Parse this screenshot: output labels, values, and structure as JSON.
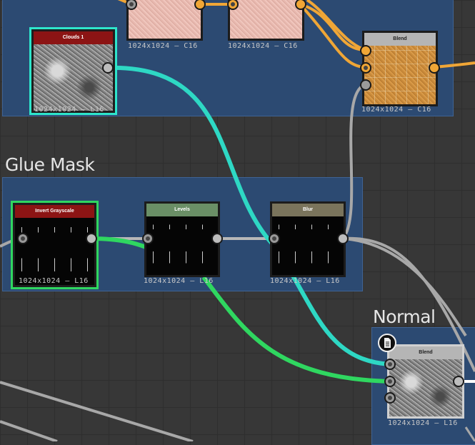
{
  "graph": {
    "frames": {
      "top": {
        "title": ""
      },
      "glue_mask": {
        "title": "Glue Mask"
      },
      "normal": {
        "title": "Normal"
      }
    },
    "nodes": {
      "pink1": {
        "title": "",
        "resolution": "1024x1024 – C16"
      },
      "pink2": {
        "title": "",
        "resolution": "1024x1024 – C16"
      },
      "clouds": {
        "title": "Clouds 1",
        "resolution": "1024x1024 – L16"
      },
      "blend_top": {
        "title": "Blend",
        "resolution": "1024x1024 – C16"
      },
      "invert": {
        "title": "Invert Grayscale",
        "resolution": "1024x1024 – L16"
      },
      "levels": {
        "title": "Levels",
        "resolution": "1024x1024 – L16"
      },
      "blur": {
        "title": "Blur",
        "resolution": "1024x1024 – L16"
      },
      "blend_normal": {
        "title": "Blend",
        "resolution": "1024x1024 – L16"
      }
    }
  },
  "colors": {
    "frame_bg": "#2c4a72",
    "link_orange": "#f0a636",
    "link_cyan": "#2ed8c4",
    "link_green": "#2fd760",
    "link_gray": "#a8a8a8",
    "header_red": "#8c1414",
    "header_green": "#6a8f66",
    "header_olive": "#7a745c",
    "header_gray": "#b5b5b5"
  },
  "icons": {
    "normal_node_badge": "document-icon"
  }
}
